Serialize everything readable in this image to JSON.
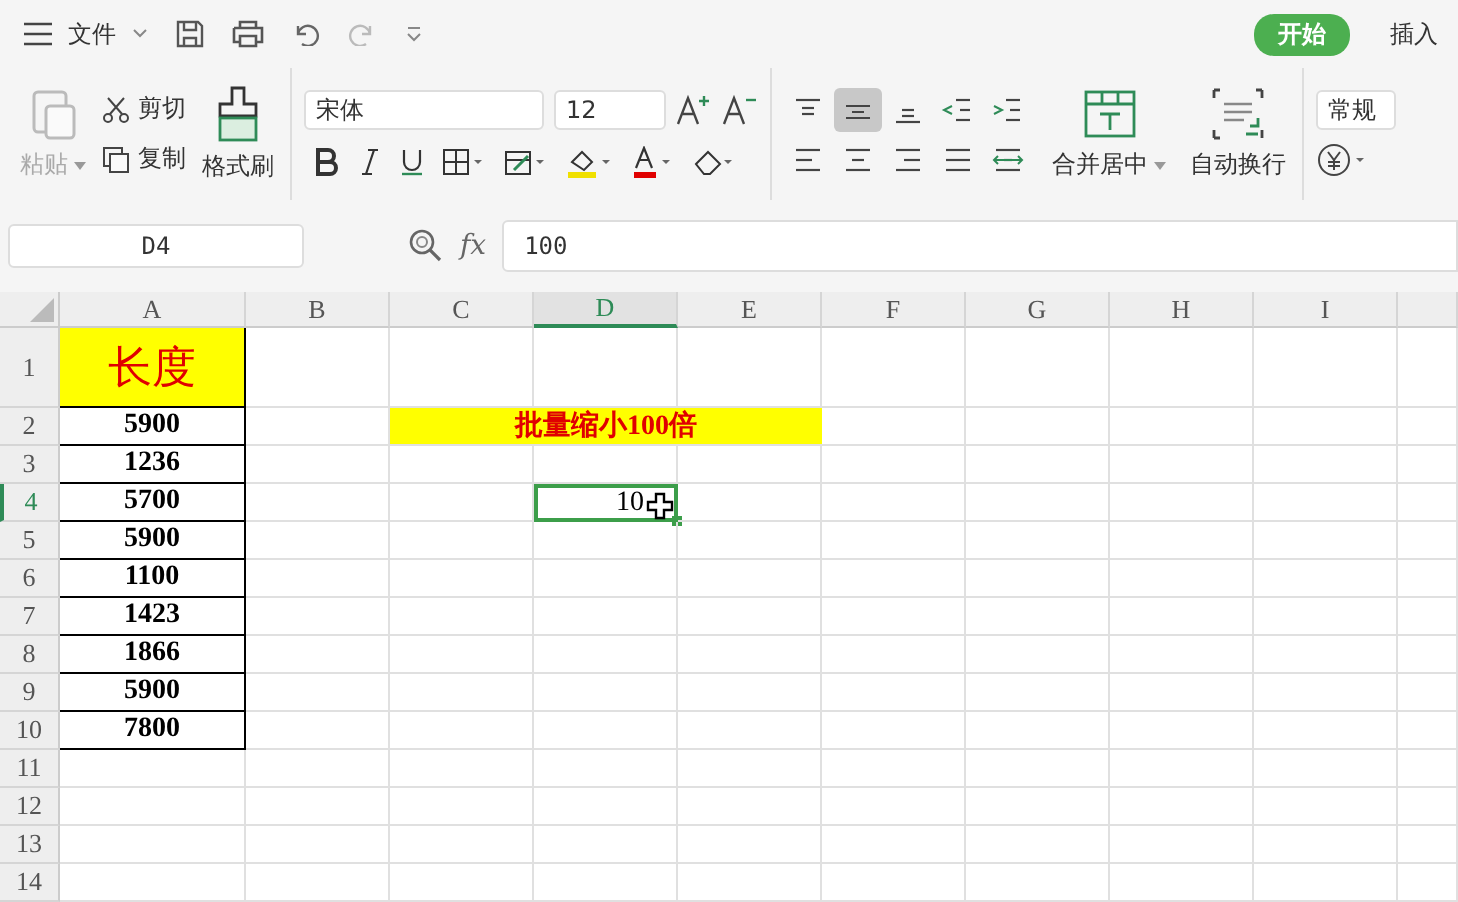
{
  "title_bar": {
    "menu": "文件",
    "tabs": [
      {
        "label": "开始",
        "selected": true
      },
      {
        "label": "插入",
        "selected": false
      }
    ]
  },
  "ribbon": {
    "paste": {
      "label": "粘贴",
      "disabled": true
    },
    "cut": "剪切",
    "copy": "复制",
    "format_painter": "格式刷",
    "font_name": "宋体",
    "font_size": "12",
    "align": [
      {
        "kind": "top",
        "selected": false
      },
      {
        "kind": "middle",
        "selected": true
      },
      {
        "kind": "bottom",
        "selected": false
      },
      {
        "kind": "outdent",
        "selected": false
      },
      {
        "kind": "indent",
        "selected": false
      },
      {
        "kind": "left",
        "selected": false
      },
      {
        "kind": "center",
        "selected": false
      },
      {
        "kind": "right",
        "selected": false
      },
      {
        "kind": "justify",
        "selected": false
      },
      {
        "kind": "distribute",
        "selected": false
      }
    ],
    "merge": "合并居中",
    "wrap": "自动换行",
    "number_format": "常规"
  },
  "formula_bar": {
    "cell_ref": "D4",
    "function_label": "fx",
    "formula": "100"
  },
  "sheet": {
    "columns": [
      {
        "label": "A",
        "selected": false
      },
      {
        "label": "B",
        "selected": false
      },
      {
        "label": "C",
        "selected": false
      },
      {
        "label": "D",
        "selected": true
      },
      {
        "label": "E",
        "selected": false
      },
      {
        "label": "F",
        "selected": false
      },
      {
        "label": "G",
        "selected": false
      },
      {
        "label": "H",
        "selected": false
      },
      {
        "label": "I",
        "selected": false
      }
    ],
    "rows": [
      {
        "label": "1",
        "selected": false,
        "a": "长度",
        "kind": "header"
      },
      {
        "label": "2",
        "selected": false,
        "a": "5900",
        "kind": "value"
      },
      {
        "label": "3",
        "selected": false,
        "a": "1236",
        "kind": "value"
      },
      {
        "label": "4",
        "selected": true,
        "a": "5700",
        "kind": "value"
      },
      {
        "label": "5",
        "selected": false,
        "a": "5900",
        "kind": "value"
      },
      {
        "label": "6",
        "selected": false,
        "a": "1100",
        "kind": "value"
      },
      {
        "label": "7",
        "selected": false,
        "a": "1423",
        "kind": "value"
      },
      {
        "label": "8",
        "selected": false,
        "a": "1866",
        "kind": "value"
      },
      {
        "label": "9",
        "selected": false,
        "a": "5900",
        "kind": "value"
      },
      {
        "label": "10",
        "selected": false,
        "a": "7800",
        "kind": "value"
      },
      {
        "label": "11",
        "selected": false,
        "kind": "empty"
      },
      {
        "label": "12",
        "selected": false,
        "kind": "empty"
      },
      {
        "label": "13",
        "selected": false,
        "kind": "empty"
      },
      {
        "label": "14",
        "selected": false,
        "kind": "empty"
      }
    ],
    "banner": "批量缩小100倍",
    "active_cell": "10"
  }
}
